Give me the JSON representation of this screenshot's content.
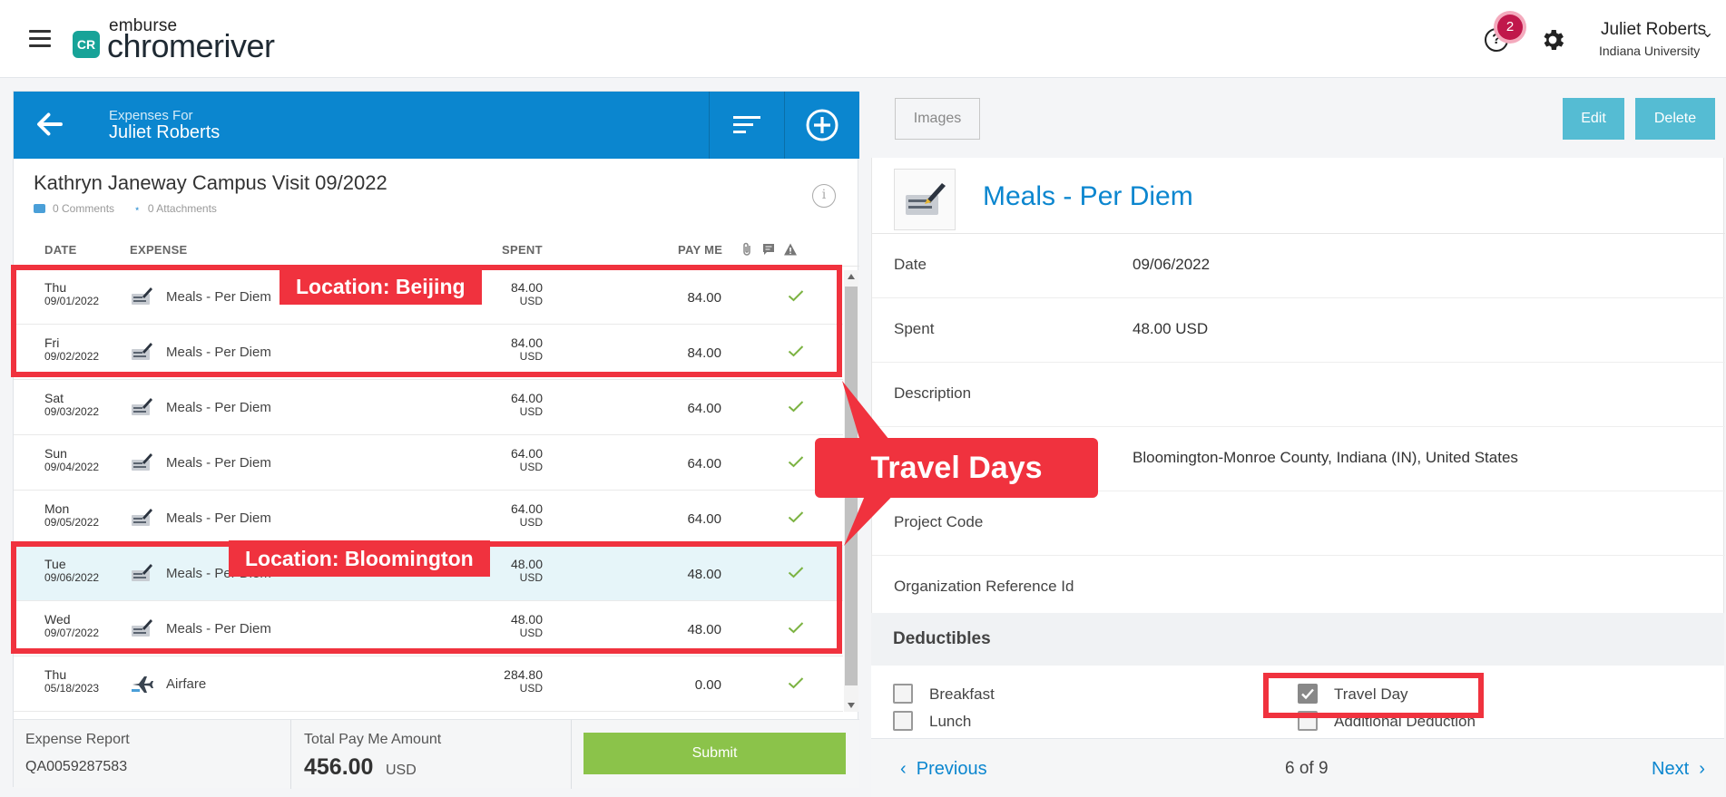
{
  "app": {
    "logo_top": "emburse",
    "logo_main": "chromeriver",
    "logo_badge": "CR"
  },
  "topbar": {
    "help_badge_count": "2",
    "help_icon": "?",
    "user_name": "Juliet Roberts",
    "user_org": "Indiana University"
  },
  "report": {
    "header_subtitle": "Expenses For",
    "header_name": "Juliet Roberts",
    "title": "Kathryn Janeway Campus Visit 09/2022",
    "comments": "0 Comments",
    "attachments": "0 Attachments",
    "columns": {
      "date": "DATE",
      "expense": "EXPENSE",
      "spent": "SPENT",
      "pay_me": "PAY ME"
    },
    "rows": [
      {
        "day": "Thu",
        "date": "09/01/2022",
        "icon": "meals-icon",
        "expense": "Meals - Per Diem",
        "spent": "84.00",
        "currency": "USD",
        "pay_me": "84.00",
        "selected": false
      },
      {
        "day": "Fri",
        "date": "09/02/2022",
        "icon": "meals-icon",
        "expense": "Meals - Per Diem",
        "spent": "84.00",
        "currency": "USD",
        "pay_me": "84.00",
        "selected": false
      },
      {
        "day": "Sat",
        "date": "09/03/2022",
        "icon": "meals-icon",
        "expense": "Meals - Per Diem",
        "spent": "64.00",
        "currency": "USD",
        "pay_me": "64.00",
        "selected": false
      },
      {
        "day": "Sun",
        "date": "09/04/2022",
        "icon": "meals-icon",
        "expense": "Meals - Per Diem",
        "spent": "64.00",
        "currency": "USD",
        "pay_me": "64.00",
        "selected": false
      },
      {
        "day": "Mon",
        "date": "09/05/2022",
        "icon": "meals-icon",
        "expense": "Meals - Per Diem",
        "spent": "64.00",
        "currency": "USD",
        "pay_me": "64.00",
        "selected": false
      },
      {
        "day": "Tue",
        "date": "09/06/2022",
        "icon": "meals-icon",
        "expense": "Meals - Per Diem",
        "spent": "48.00",
        "currency": "USD",
        "pay_me": "48.00",
        "selected": true
      },
      {
        "day": "Wed",
        "date": "09/07/2022",
        "icon": "meals-icon",
        "expense": "Meals - Per Diem",
        "spent": "48.00",
        "currency": "USD",
        "pay_me": "48.00",
        "selected": false
      },
      {
        "day": "Thu",
        "date": "05/18/2023",
        "icon": "airfare-icon",
        "expense": "Airfare",
        "spent": "284.80",
        "currency": "USD",
        "pay_me": "0.00",
        "selected": false
      }
    ],
    "footer": {
      "report_label": "Expense Report",
      "report_id": "QA0059287583",
      "total_label": "Total Pay Me Amount",
      "total_amount": "456.00",
      "total_currency": "USD",
      "submit_label": "Submit"
    }
  },
  "detail": {
    "images_label": "Images",
    "edit_label": "Edit",
    "delete_label": "Delete",
    "title": "Meals - Per Diem",
    "fields": [
      {
        "label": "Date",
        "value": "09/06/2022"
      },
      {
        "label": "Spent",
        "value": "48.00 USD"
      },
      {
        "label": "Description",
        "value": ""
      },
      {
        "label": "",
        "value": "Bloomington-Monroe County, Indiana (IN), United States"
      },
      {
        "label": "Project Code",
        "value": ""
      },
      {
        "label": "Organization Reference Id",
        "value": ""
      }
    ],
    "deductibles_title": "Deductibles",
    "deductibles": [
      {
        "label": "Breakfast",
        "checked": false
      },
      {
        "label": "Travel Day",
        "checked": true
      },
      {
        "label": "Lunch",
        "checked": false
      },
      {
        "label": "Additional Deduction",
        "checked": false
      }
    ],
    "nav": {
      "previous": "Previous",
      "page": "6 of 9",
      "next": "Next"
    }
  },
  "annotations": {
    "beijing": "Location: Beijing",
    "bloomington": "Location: Bloomington",
    "travel_days": "Travel Days"
  },
  "colors": {
    "brand_blue": "#0b86cf",
    "annotation_red": "#f0323e",
    "submit_green": "#8bc34a",
    "action_teal": "#55bcd3",
    "check_green": "#7cb342"
  }
}
